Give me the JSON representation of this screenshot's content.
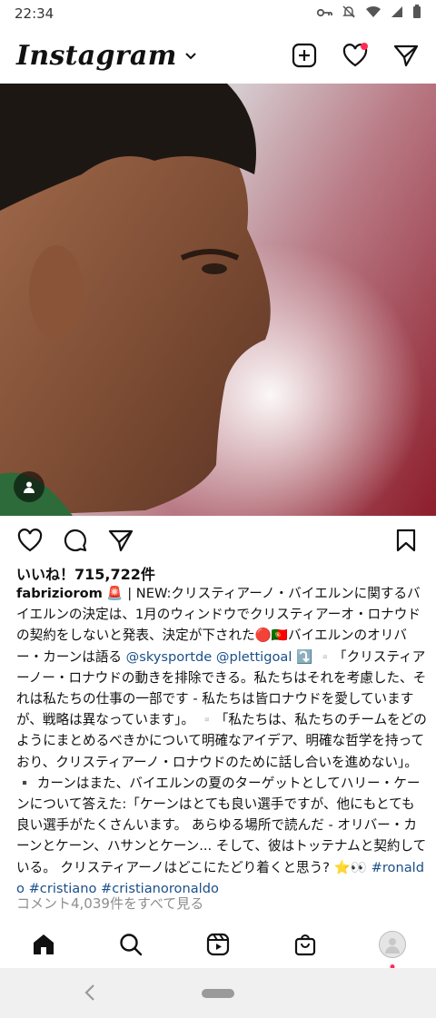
{
  "status_bar": {
    "time": "22:34"
  },
  "header": {
    "app_name": "Instagram"
  },
  "post": {
    "likes_text": "いいね！715,722件",
    "caption": {
      "username": "fabriziorom",
      "text_1": " 🚨 | NEW:クリスティアーノ・バイエルンに関するバイエルンの決定は、1月のウィンドウでクリスティアーオ・ロナウドの契約をしないと発表、決定が下された🔴🇵🇹バイエルンのオリバー・カーンは語る ",
      "mention_1": "@skysportde",
      "mention_2": "@plettigoal",
      "text_2": " ⤵️ ▫️「クリスティアーノー・ロナウドの動きを排除できる。私たちはそれを考慮した、それは私たちの仕事の一部です - 私たちは皆ロナウドを愛していますが、戦略は異なっています」。 ▫️「私たちは、私たちのチームをどのようにまとめるべきかについて明確なアイデア、明確な哲学を持っており、クリスティアーノ・ロナウドのために話し合いを進めない」。 ▪️ カーンはまた、バイエルンの夏のターゲットとしてハリー・ケーンについて答えた:「ケーンはとても良い選手ですが、他にもとても良い選手がたくさんいます。 あらゆる場所で読んだ - オリバー・カーンとケーン、ハサンとケーン... そして、彼はトッテナムと契約している。 クリスティアーノはどこにたどり着くと思う? ⭐👀 ",
      "hashtag_1": "#ronaldo",
      "hashtag_2": "#cristiano",
      "hashtag_3": "#cristianoronaldo"
    },
    "comments_link": "コメント4,039件をすべて見る"
  },
  "colors": {
    "link": "#1a4f8a",
    "notification": "#ff2d55"
  }
}
